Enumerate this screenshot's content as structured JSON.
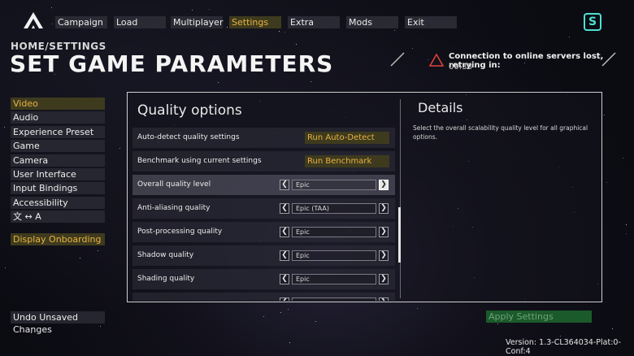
{
  "topnav": {
    "items": [
      {
        "label": "Campaign",
        "active": false
      },
      {
        "label": "Load",
        "active": false
      },
      {
        "label": "Multiplayer",
        "active": false
      },
      {
        "label": "Settings",
        "active": true
      },
      {
        "label": "Extra",
        "active": false
      },
      {
        "label": "Mods",
        "active": false
      },
      {
        "label": "Exit",
        "active": false
      }
    ],
    "brand_badge": "S"
  },
  "header": {
    "breadcrumb": "HOME/SETTINGS",
    "title": "SET GAME PARAMETERS"
  },
  "notification": {
    "message": "Connection to online servers lost, retrying in:",
    "countdown": "00:38",
    "icon": "warning-triangle-icon",
    "color": "#e5423a"
  },
  "sidebar": {
    "items": [
      {
        "label": "Video",
        "active": true
      },
      {
        "label": "Audio",
        "active": false
      },
      {
        "label": "Experience Preset",
        "active": false
      },
      {
        "label": "Game",
        "active": false
      },
      {
        "label": "Camera",
        "active": false
      },
      {
        "label": "User Interface",
        "active": false
      },
      {
        "label": "Input Bindings",
        "active": false
      },
      {
        "label": "Accessibility",
        "active": false
      },
      {
        "label": "文 ↔ A",
        "active": false
      }
    ],
    "onboarding_label": "Display Onboarding"
  },
  "quality_options": {
    "title": "Quality options",
    "actions": [
      {
        "label": "Auto-detect quality settings",
        "button": "Run Auto-Detect"
      },
      {
        "label": "Benchmark using current settings",
        "button": "Run Benchmark"
      }
    ],
    "settings": [
      {
        "label": "Overall quality level",
        "value": "Epic",
        "selected": true
      },
      {
        "label": "Anti-aliasing quality",
        "value": "Epic (TAA)",
        "selected": false
      },
      {
        "label": "Post-processing quality",
        "value": "Epic",
        "selected": false
      },
      {
        "label": "Shadow quality",
        "value": "Epic",
        "selected": false
      },
      {
        "label": "Shading quality",
        "value": "Epic",
        "selected": false
      }
    ]
  },
  "details": {
    "title": "Details",
    "description": "Select the overall scalability quality level for all graphical options."
  },
  "footer": {
    "undo_label": "Undo Unsaved Changes",
    "apply_label": "Apply Settings",
    "version": "Version: 1.3-CL364034-Plat:0-Conf:4"
  },
  "colors": {
    "accent": "#e8b341",
    "accent_bg": "#3e3a1e",
    "brand": "#4de0d4",
    "apply_bg": "#1b5a2a"
  }
}
